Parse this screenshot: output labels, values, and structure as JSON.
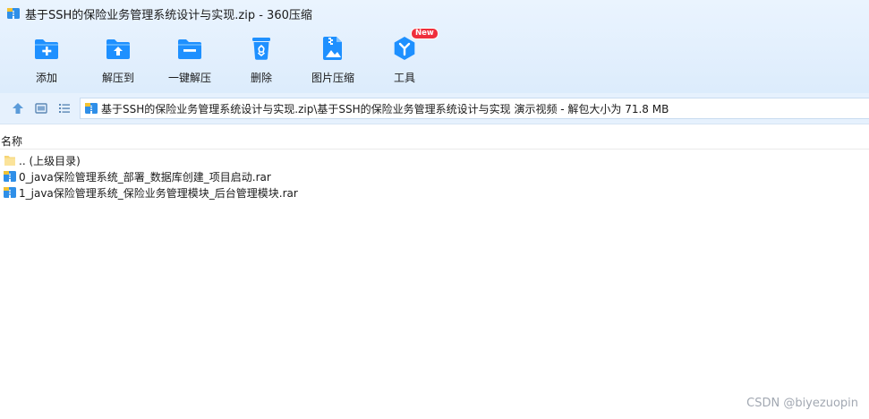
{
  "window": {
    "title": "基于SSH的保险业务管理系统设计与实现.zip - 360压缩"
  },
  "toolbar": {
    "items": [
      {
        "label": "添加",
        "icon": "add-folder-icon"
      },
      {
        "label": "解压到",
        "icon": "extract-to-icon"
      },
      {
        "label": "一键解压",
        "icon": "one-click-extract-icon"
      },
      {
        "label": "删除",
        "icon": "recycle-bin-icon"
      },
      {
        "label": "图片压缩",
        "icon": "image-compress-icon"
      },
      {
        "label": "工具",
        "icon": "tools-icon",
        "badge": "New"
      }
    ]
  },
  "nav": {
    "up_icon": "up-arrow-icon",
    "details_view_icon": "details-view-icon",
    "list_view_icon": "list-view-icon",
    "address": "基于SSH的保险业务管理系统设计与实现.zip\\基于SSH的保险业务管理系统设计与实现 演示视频 - 解包大小为 71.8 MB"
  },
  "list": {
    "column_name": "名称",
    "rows": [
      {
        "name": ".. (上级目录)",
        "icon": "folder-icon"
      },
      {
        "name": "0_java保险管理系统_部署_数据库创建_项目启动.rar",
        "icon": "rar-archive-icon"
      },
      {
        "name": "1_java保险管理系统_保险业务管理模块_后台管理模块.rar",
        "icon": "rar-archive-icon"
      }
    ]
  },
  "watermark": "CSDN @biyezuopin",
  "colors": {
    "accent": "#1e90ff",
    "toolbar_bg": "#e2effd",
    "badge": "#ef2f3c"
  }
}
